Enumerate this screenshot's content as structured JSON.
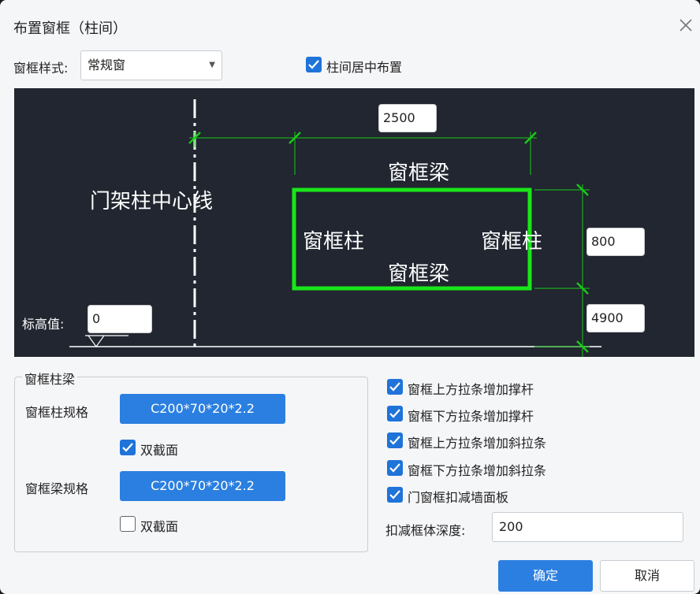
{
  "title": "布置窗框（柱间）",
  "style": {
    "label": "窗框样式:",
    "value": "常规窗"
  },
  "center_option": {
    "label": "柱间居中布置",
    "checked": true
  },
  "canvas": {
    "width_value": "2500",
    "height_value": "800",
    "offset_value": "4900",
    "elevation_label": "标高值:",
    "elevation_value": "0",
    "center_line_label": "门架柱中心线",
    "beam_top_label": "窗框梁",
    "beam_bottom_label": "窗框梁",
    "column_left_label": "窗框柱",
    "column_right_label": "窗框柱",
    "frame_color": "#19e619"
  },
  "group": {
    "title": "窗框柱梁",
    "column_spec_label": "窗框柱规格",
    "column_spec_value": "C200*70*20*2.2",
    "column_double": {
      "label": "双截面",
      "checked": true
    },
    "beam_spec_label": "窗框梁规格",
    "beam_spec_value": "C200*70*20*2.2",
    "beam_double": {
      "label": "双截面",
      "checked": false
    }
  },
  "options": [
    {
      "label": "窗框上方拉条增加撑杆",
      "checked": true
    },
    {
      "label": "窗框下方拉条增加撑杆",
      "checked": true
    },
    {
      "label": "窗框上方拉条增加斜拉条",
      "checked": true
    },
    {
      "label": "窗框下方拉条增加斜拉条",
      "checked": true
    },
    {
      "label": "门窗框扣减墙面板",
      "checked": true
    }
  ],
  "depth": {
    "label": "扣减框体深度:",
    "value": "200"
  },
  "buttons": {
    "ok": "确定",
    "cancel": "取消"
  }
}
